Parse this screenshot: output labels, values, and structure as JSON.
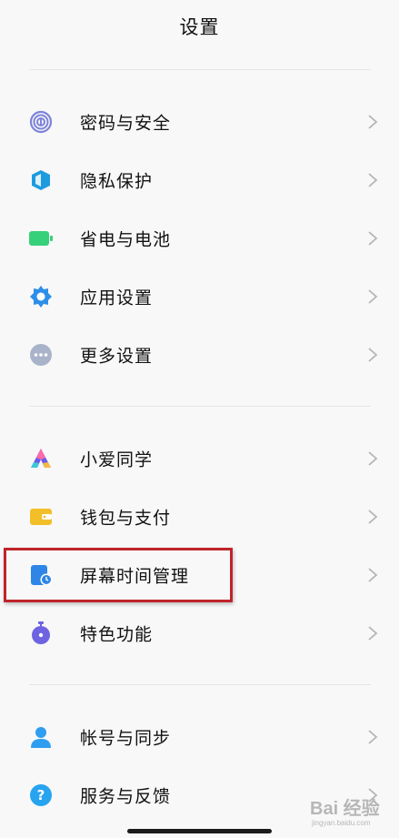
{
  "header": {
    "title": "设置"
  },
  "groups": [
    {
      "items": [
        {
          "label": "密码与安全",
          "icon": "fingerprint-icon",
          "color": "#7c83d9"
        },
        {
          "label": "隐私保护",
          "icon": "privacy-shield-icon",
          "color": "#1d9bde"
        },
        {
          "label": "省电与电池",
          "icon": "battery-icon",
          "color": "#37d07a"
        },
        {
          "label": "应用设置",
          "icon": "gear-icon",
          "color": "#2e8fe8"
        },
        {
          "label": "更多设置",
          "icon": "more-dots-icon",
          "color": "#8f9bb3"
        }
      ]
    },
    {
      "items": [
        {
          "label": "小爱同学",
          "icon": "xiaoai-icon",
          "color": "#6d5ce8"
        },
        {
          "label": "钱包与支付",
          "icon": "wallet-icon",
          "color": "#f2bf2a"
        },
        {
          "label": "屏幕时间管理",
          "icon": "screen-time-icon",
          "color": "#2f86e6"
        },
        {
          "label": "特色功能",
          "icon": "stopwatch-icon",
          "color": "#6e63e0"
        }
      ]
    },
    {
      "items": [
        {
          "label": "帐号与同步",
          "icon": "account-icon",
          "color": "#2f9ef0"
        },
        {
          "label": "服务与反馈",
          "icon": "help-icon",
          "color": "#27a3f0"
        }
      ]
    }
  ],
  "watermark": {
    "text": "Bai 经验",
    "sub": "jingyan.baidu.com"
  }
}
